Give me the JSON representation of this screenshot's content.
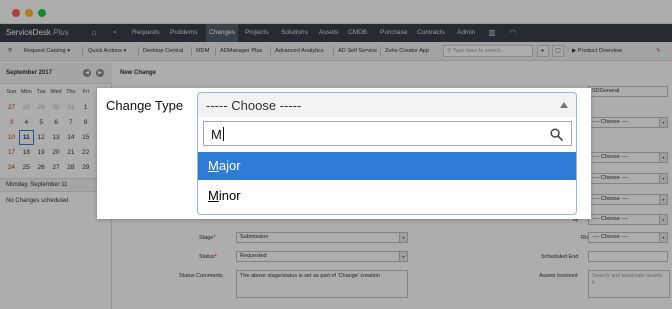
{
  "app": {
    "logo_text": "ServiceDesk",
    "logo_plus": "Plus"
  },
  "nav": {
    "items": [
      "Requests",
      "Problems",
      "Changes",
      "Projects",
      "Solutions",
      "Assets",
      "CMDB",
      "Purchase",
      "Contracts",
      "Admin"
    ],
    "active": "Changes"
  },
  "toolbar": {
    "items": [
      "Request Catalog",
      "Quick Actions",
      "Desktop Central",
      "MDM",
      "ADManager Plus",
      "Advanced Analytics",
      "AD Self Service",
      "Zoho Creator App"
    ],
    "search_placeholder": "Type here to search...",
    "product_overview": "Product Overview"
  },
  "calendar": {
    "month_label": "September 2017",
    "weekdays": [
      "Sun",
      "Mon",
      "Tue",
      "Wed",
      "Thu",
      "Fri",
      "Sat"
    ],
    "weeks": [
      [
        "27",
        "28",
        "29",
        "30",
        "31",
        "1",
        "2"
      ],
      [
        "3",
        "4",
        "5",
        "6",
        "7",
        "8",
        "9"
      ],
      [
        "10",
        "11",
        "12",
        "13",
        "14",
        "15",
        "16"
      ],
      [
        "17",
        "18",
        "19",
        "20",
        "21",
        "22",
        "23"
      ],
      [
        "24",
        "25",
        "26",
        "27",
        "28",
        "29",
        "30"
      ]
    ],
    "selected_day_label": "Monday, September 11",
    "no_changes": "No Changes scheduled"
  },
  "form": {
    "title": "New Change",
    "stage_label": "Stage",
    "stage_value": "Submission",
    "status_label": "Status",
    "status_value": "Requested",
    "status_comments_label": "Status Comments",
    "status_comments_value": "The above stage/status is set as part of 'Change' creation",
    "scheduled_end_label": "Scheduled End",
    "assets_involved_label": "Assets Involved",
    "assets_placeholder": "Search and associate assets h",
    "risk_label": "Risk",
    "right_template_value": "SDGeneral",
    "right_label_fragments": [
      "up",
      "er",
      "uct",
      "cy",
      "ity",
      "Risk"
    ],
    "choose_placeholder": "---- Choose ----"
  },
  "dropdown": {
    "field_label": "Change Type",
    "placeholder": "----- Choose -----",
    "search_value": "M",
    "options": [
      {
        "label_first": "M",
        "label_rest": "ajor",
        "highlighted": true
      },
      {
        "label_first": "M",
        "label_rest": "inor",
        "highlighted": false
      }
    ]
  },
  "colors": {
    "nav_bg": "#3a3f45",
    "highlight": "#2e7bd6",
    "required": "#d0021b"
  }
}
